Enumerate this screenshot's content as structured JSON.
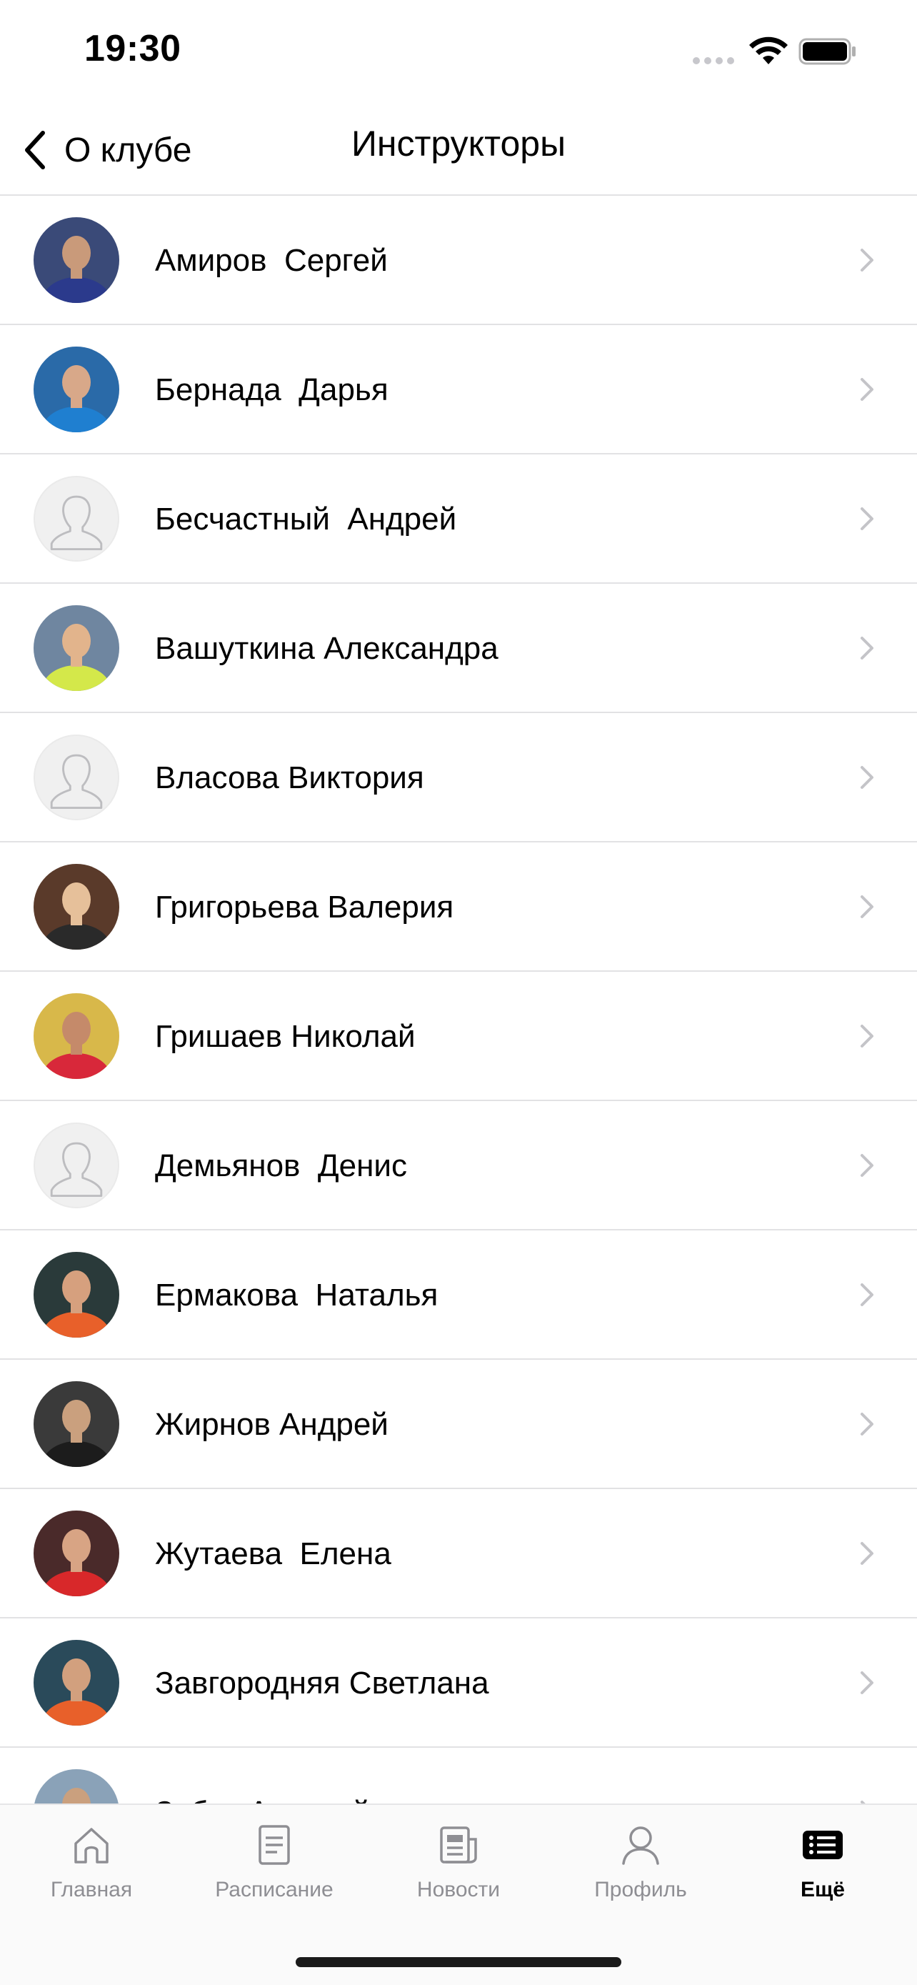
{
  "status_bar": {
    "time": "19:30"
  },
  "nav": {
    "back_label": "О клубе",
    "title": "Инструкторы"
  },
  "instructors": [
    {
      "name": "Амиров  Сергей",
      "avatar": "photo",
      "bg": "#3a4a78",
      "skin": "#c99a7a",
      "shirt": "#2b3a8c"
    },
    {
      "name": "Бернада  Дарья",
      "avatar": "photo",
      "bg": "#2a6aa8",
      "skin": "#d8a889",
      "shirt": "#1f7fd0"
    },
    {
      "name": "Бесчастный  Андрей",
      "avatar": "placeholder"
    },
    {
      "name": "Вашуткина Александра",
      "avatar": "photo",
      "bg": "#6f86a0",
      "skin": "#e2b48c",
      "shirt": "#d4e84a"
    },
    {
      "name": "Власова Виктория",
      "avatar": "placeholder"
    },
    {
      "name": "Григорьева Валерия",
      "avatar": "photo",
      "bg": "#5a3a2a",
      "skin": "#e6c09a",
      "shirt": "#2a2a2a"
    },
    {
      "name": "Гришаев Николай",
      "avatar": "photo",
      "bg": "#d8b84a",
      "skin": "#c58a6a",
      "shirt": "#d8283a"
    },
    {
      "name": "Демьянов  Денис",
      "avatar": "placeholder"
    },
    {
      "name": "Ермакова  Наталья",
      "avatar": "photo",
      "bg": "#2a3a3a",
      "skin": "#d6a07e",
      "shirt": "#e8602a"
    },
    {
      "name": "Жирнов Андрей",
      "avatar": "photo",
      "bg": "#3a3a3a",
      "skin": "#caa07e",
      "shirt": "#1c1c1c"
    },
    {
      "name": "Жутаева  Елена",
      "avatar": "photo",
      "bg": "#4a2a2a",
      "skin": "#d8a484",
      "shirt": "#d8282a"
    },
    {
      "name": "Завгородняя Светлана",
      "avatar": "photo",
      "bg": "#2a4a5a",
      "skin": "#d2a07e",
      "shirt": "#e8602a"
    },
    {
      "name": "Зубко Алексей",
      "avatar": "photo",
      "bg": "#8aa2b8",
      "skin": "#caa07e",
      "shirt": "#3a4a5a"
    }
  ],
  "tabs": [
    {
      "label": "Главная",
      "icon": "home-icon",
      "active": false
    },
    {
      "label": "Расписание",
      "icon": "schedule-icon",
      "active": false
    },
    {
      "label": "Новости",
      "icon": "news-icon",
      "active": false
    },
    {
      "label": "Профиль",
      "icon": "profile-icon",
      "active": false
    },
    {
      "label": "Ещё",
      "icon": "more-icon",
      "active": true
    }
  ],
  "colors": {
    "separator": "#e2e2e4",
    "chevron": "#c4c4c8",
    "tab_inactive": "#8e8e93",
    "tab_active": "#000000"
  }
}
